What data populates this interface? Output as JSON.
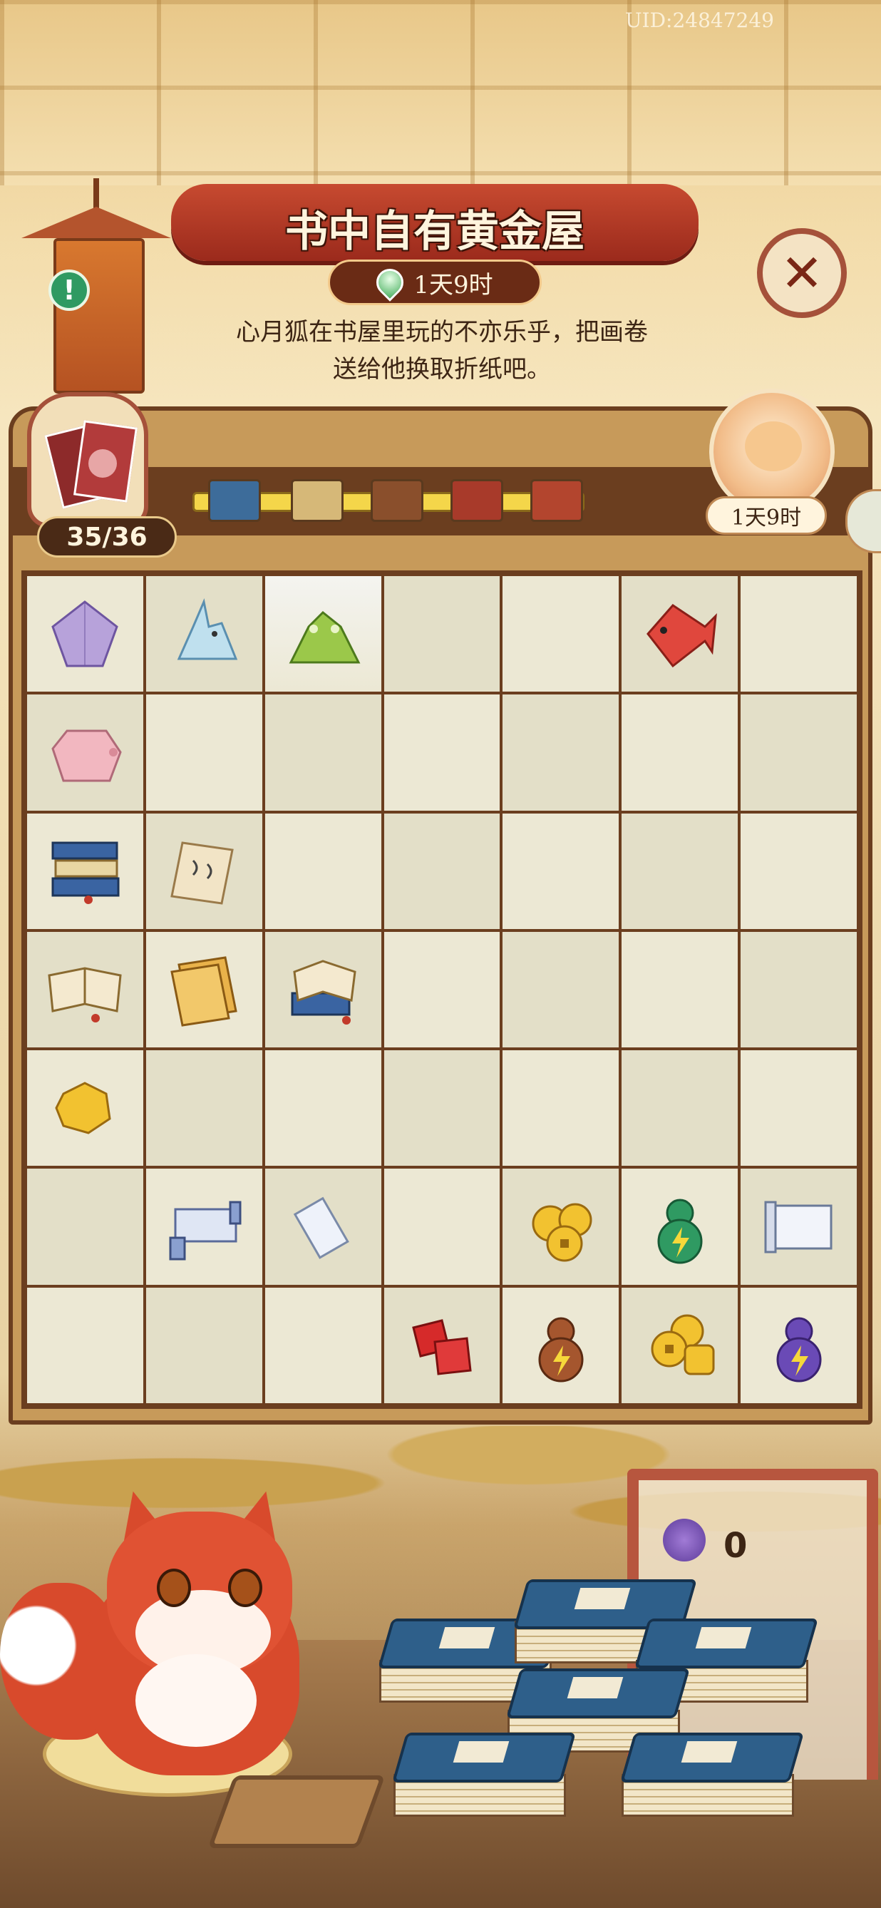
{
  "uid": "UID:24847249",
  "event": {
    "title": "书中自有黄金屋",
    "timer": "1天9时",
    "description_line1": "心月狐在书屋里玩的不亦乐乎，把画卷",
    "description_line2": "送给他换取折纸吧。"
  },
  "progress": {
    "collected": "35/36",
    "milestones": 5,
    "reward_timer": "1天9时"
  },
  "board": {
    "rows": [
      [
        "origami-balloon",
        "origami-rabbit",
        "origami-frog",
        "",
        "",
        "origami-fish",
        ""
      ],
      [
        "origami-pig",
        "",
        "",
        "",
        "",
        "",
        ""
      ],
      [
        "stacked-books",
        "note-paper",
        "",
        "",
        "",
        "",
        ""
      ],
      [
        "open-book",
        "booklets",
        "open-book-stack",
        "",
        "",
        "",
        ""
      ],
      [
        "gold-nugget",
        "",
        "",
        "",
        "",
        "",
        ""
      ],
      [
        "",
        "large-scroll",
        "small-scroll",
        "",
        "coin-stack",
        "green-energy-gourd",
        "paper-scroll"
      ],
      [
        "",
        "",
        "",
        "red-gems",
        "brown-energy-gourd",
        "large-coin-stack",
        "purple-energy-gourd"
      ]
    ]
  },
  "inventory": {
    "duster_count": "0"
  },
  "colors": {
    "board_cell": "#ece8d4",
    "panel_frame": "#6b3e1f",
    "accent_red": "#c74a30"
  }
}
